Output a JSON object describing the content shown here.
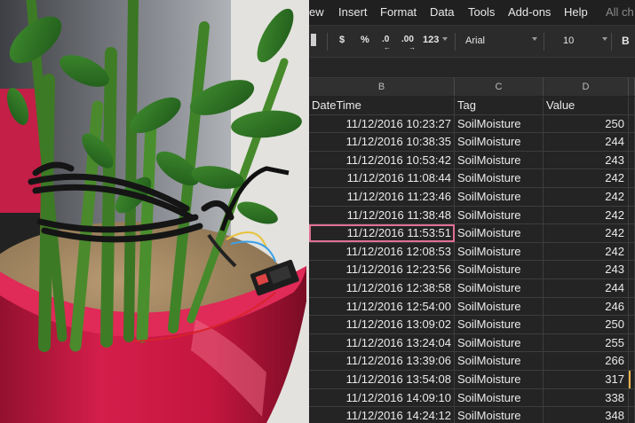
{
  "menu": {
    "items": [
      "ew",
      "Insert",
      "Format",
      "Data",
      "Tools",
      "Add-ons",
      "Help"
    ],
    "trailing": "All ch"
  },
  "toolbar": {
    "currency": "$",
    "percent": "%",
    "dec_less": ".0",
    "dec_more": ".00",
    "more_formats": "123",
    "font": "Arial",
    "size": "10",
    "bold": "B"
  },
  "columns": [
    "B",
    "C",
    "D"
  ],
  "header": {
    "datetime": "DateTime",
    "tag": "Tag",
    "value": "Value"
  },
  "rows": [
    [
      "11/12/2016 10:23:27",
      "SoilMoisture",
      "250"
    ],
    [
      "11/12/2016 10:38:35",
      "SoilMoisture",
      "244"
    ],
    [
      "11/12/2016 10:53:42",
      "SoilMoisture",
      "243"
    ],
    [
      "11/12/2016 11:08:44",
      "SoilMoisture",
      "242"
    ],
    [
      "11/12/2016 11:23:46",
      "SoilMoisture",
      "242"
    ],
    [
      "11/12/2016 11:38:48",
      "SoilMoisture",
      "242"
    ],
    [
      "11/12/2016 11:53:51",
      "SoilMoisture",
      "242"
    ],
    [
      "11/12/2016 12:08:53",
      "SoilMoisture",
      "242"
    ],
    [
      "11/12/2016 12:23:56",
      "SoilMoisture",
      "243"
    ],
    [
      "11/12/2016 12:38:58",
      "SoilMoisture",
      "244"
    ],
    [
      "11/12/2016 12:54:00",
      "SoilMoisture",
      "246"
    ],
    [
      "11/12/2016 13:09:02",
      "SoilMoisture",
      "250"
    ],
    [
      "11/12/2016 13:24:04",
      "SoilMoisture",
      "255"
    ],
    [
      "11/12/2016 13:39:06",
      "SoilMoisture",
      "266"
    ],
    [
      "11/12/2016 13:54:08",
      "SoilMoisture",
      "317"
    ],
    [
      "11/12/2016 14:09:10",
      "SoilMoisture",
      "338"
    ],
    [
      "11/12/2016 14:24:12",
      "SoilMoisture",
      "348"
    ]
  ],
  "selected_row": 6,
  "colors": {
    "sheet_bg": "#242424",
    "selection": "#e26f93",
    "pot": "#d41e4b"
  }
}
